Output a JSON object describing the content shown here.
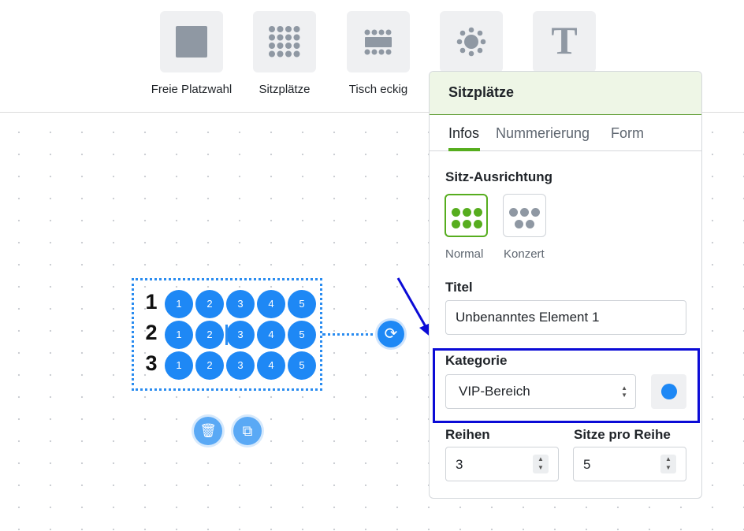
{
  "toolbar": {
    "tools": [
      {
        "label": "Freie Platzwahl",
        "icon": "square-icon"
      },
      {
        "label": "Sitzplätze",
        "icon": "seat-grid-icon"
      },
      {
        "label": "Tisch eckig",
        "icon": "rect-table-icon"
      },
      {
        "label": "",
        "icon": "round-table-icon"
      },
      {
        "label": "",
        "icon": "text-icon",
        "glyph": "T"
      }
    ]
  },
  "canvas": {
    "rows": [
      "1",
      "2",
      "3"
    ],
    "seats": [
      "1",
      "2",
      "3",
      "4",
      "5"
    ],
    "rotate_glyph": "⟳",
    "delete_glyph": "🗑",
    "duplicate_glyph": "⧉"
  },
  "panel": {
    "title": "Sitzplätze",
    "tabs": [
      "Infos",
      "Nummerierung",
      "Form"
    ],
    "active_tab": "Infos",
    "orientation_label": "Sitz-Ausrichtung",
    "orientation_options": [
      "Normal",
      "Konzert"
    ],
    "selected_orientation": "Normal",
    "title_label": "Titel",
    "title_value": "Unbenanntes Element 1",
    "category_label": "Kategorie",
    "category_value": "VIP-Bereich",
    "category_color": "#1e88f5",
    "rows_label": "Reihen",
    "rows_value": "3",
    "seats_per_row_label": "Sitze pro Reihe",
    "seats_per_row_value": "5"
  },
  "colors": {
    "accent_green": "#56ad1e",
    "seat_blue": "#1e88f5",
    "highlight_blue": "#0b0bd6"
  }
}
